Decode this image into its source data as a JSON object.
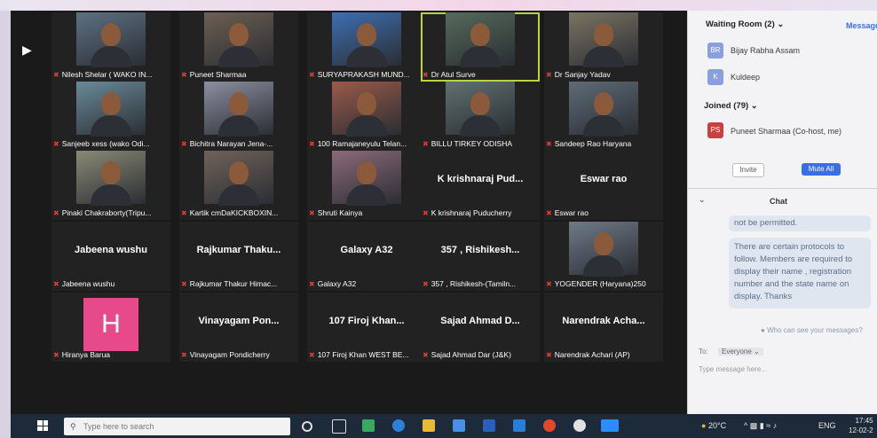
{
  "participants": [
    {
      "name": "Nilesh Shelar ( WAKO IN...",
      "type": "video",
      "active": false
    },
    {
      "name": "Puneet Sharmaa",
      "type": "video",
      "active": false
    },
    {
      "name": "SURYAPRAKASH MUND...",
      "type": "video",
      "active": false
    },
    {
      "name": "Dr Atul Surve",
      "type": "video",
      "active": true
    },
    {
      "name": "Dr Sanjay Yadav",
      "type": "video",
      "active": false
    },
    {
      "name": "Sanjeeb xess (wako Odi...",
      "type": "video",
      "active": false
    },
    {
      "name": "Bichitra Narayan Jena-...",
      "type": "video",
      "active": false
    },
    {
      "name": "100 Ramajaneyulu Telan...",
      "type": "video",
      "active": false
    },
    {
      "name": "BILLU TIRKEY ODISHA",
      "type": "video",
      "active": false
    },
    {
      "name": "Sandeep Rao Haryana",
      "type": "video",
      "active": false
    },
    {
      "name": "Pinaki Chakraborty(Tripu...",
      "type": "video",
      "active": false
    },
    {
      "name": "Kartik cmDaKICKBOXIN...",
      "type": "video",
      "active": false
    },
    {
      "name": "Shruti Kainya",
      "type": "video",
      "active": false
    },
    {
      "name": "K krishnaraj Puducherry",
      "type": "name",
      "display": "K krishnaraj Pud...",
      "active": false
    },
    {
      "name": "Eswar rao",
      "type": "name",
      "display": "Eswar rao",
      "active": false
    },
    {
      "name": "Jabeena wushu",
      "type": "name",
      "display": "Jabeena wushu",
      "active": false
    },
    {
      "name": "Rajkumar Thakur Himac...",
      "type": "name",
      "display": "Rajkumar Thaku...",
      "active": false
    },
    {
      "name": "Galaxy A32",
      "type": "name",
      "display": "Galaxy A32",
      "active": false
    },
    {
      "name": "357 , Rishikesh-(Tamiln...",
      "type": "name",
      "display": "357 , Rishikesh...",
      "active": false
    },
    {
      "name": "YOGENDER (Haryana)250",
      "type": "video",
      "active": false
    },
    {
      "name": "Hiranya Barua",
      "type": "avatar",
      "letter": "H",
      "active": false
    },
    {
      "name": "Vinayagam Pondicherry",
      "type": "name",
      "display": "Vinayagam Pon...",
      "active": false
    },
    {
      "name": "107 Firoj Khan WEST BE...",
      "type": "name",
      "display": "107 Firoj Khan...",
      "active": false
    },
    {
      "name": "Sajad Ahmad Dar (J&K)",
      "type": "name",
      "display": "Sajad Ahmad D...",
      "active": false
    },
    {
      "name": "Narendrak Achari (AP)",
      "type": "name",
      "display": "Narendrak Acha...",
      "active": false
    }
  ],
  "panel": {
    "waiting_room_title": "Waiting Room (2)",
    "message_link": "Message",
    "waiting": [
      {
        "initials": "BR",
        "name": "Bijay Rabha Assam",
        "color": "#8a9ee0"
      },
      {
        "initials": "K",
        "name": "Kuldeep",
        "color": "#8a9ee0"
      }
    ],
    "joined_title": "Joined (79)",
    "joined": [
      {
        "initials": "PS",
        "name": "Puneet Sharmaa (Co-host, me)",
        "color": "#c84040"
      }
    ],
    "invite_label": "Invite",
    "mute_all_label": "Mute All",
    "chat_title": "Chat",
    "chat_messages": [
      "not be permitted.",
      "There are certain protocols to follow. Members are required to display  their name , registration number and the state name on display. Thanks"
    ],
    "who_can_see": "Who can see your messages?",
    "to_label": "To:",
    "to_value": "Everyone",
    "chat_placeholder": "Type message here..."
  },
  "taskbar": {
    "search_placeholder": "Type here to search",
    "temperature": "20°C",
    "language": "ENG",
    "time": "17:45",
    "date": "12-02-2"
  },
  "colors": {
    "active_speaker": "#b8d63a",
    "mute_all": "#3a6ee8",
    "avatar_h": "#e74a8a"
  }
}
